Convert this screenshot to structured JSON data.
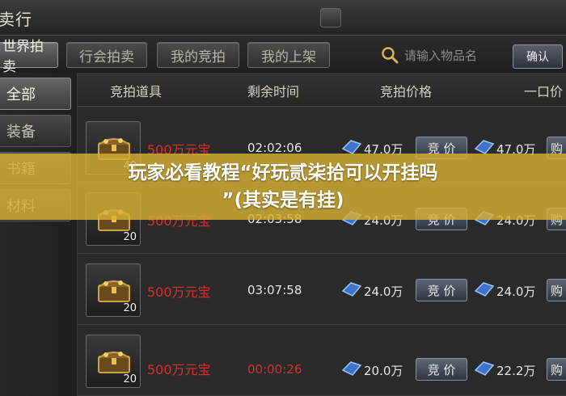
{
  "window": {
    "title": "卖行"
  },
  "tabs": [
    {
      "label": "世界拍卖",
      "active": true
    },
    {
      "label": "行会拍卖",
      "active": false
    },
    {
      "label": "我的竞拍",
      "active": false
    },
    {
      "label": "我的上架",
      "active": false
    }
  ],
  "search": {
    "placeholder": "请输入物品名",
    "confirm_label": "确认"
  },
  "categories": [
    {
      "label": "全部",
      "active": true
    },
    {
      "label": "装备",
      "active": false
    },
    {
      "label": "书籍",
      "active": false
    },
    {
      "label": "材料",
      "active": false
    }
  ],
  "columns": [
    "竞拍道具",
    "剩余时间",
    "竞拍价格",
    "一口价"
  ],
  "rows": [
    {
      "item_icon": "treasure-chest-icon",
      "quantity": "40",
      "name": "500万元宝",
      "time": "02:02:06",
      "time_warning": false,
      "bid_price": "47.0万",
      "bid_label": "竞 价",
      "buyout_price": "47.0万",
      "buy_label": "购"
    },
    {
      "item_icon": "treasure-chest-icon",
      "quantity": "20",
      "name": "500万元宝",
      "time": "02:03:58",
      "time_warning": false,
      "bid_price": "24.0万",
      "bid_label": "竞 价",
      "buyout_price": "24.0万",
      "buy_label": "购"
    },
    {
      "item_icon": "treasure-chest-icon",
      "quantity": "20",
      "name": "500万元宝",
      "time": "03:07:58",
      "time_warning": false,
      "bid_price": "24.0万",
      "bid_label": "竞 价",
      "buyout_price": "24.0万",
      "buy_label": "购"
    },
    {
      "item_icon": "treasure-chest-icon",
      "quantity": "20",
      "name": "500万元宝",
      "time": "00:00:26",
      "time_warning": true,
      "bid_price": "20.0万",
      "bid_label": "竞 价",
      "buyout_price": "22.2万",
      "buy_label": "购"
    }
  ],
  "banner": {
    "line1": "玩家必看教程“好玩贰柒拾可以开挂吗",
    "line2": "”(其实是有挂)"
  },
  "colors": {
    "item_name": "#d8322f",
    "banner_bg": "#d6b034",
    "text": "#e6e6e6"
  }
}
